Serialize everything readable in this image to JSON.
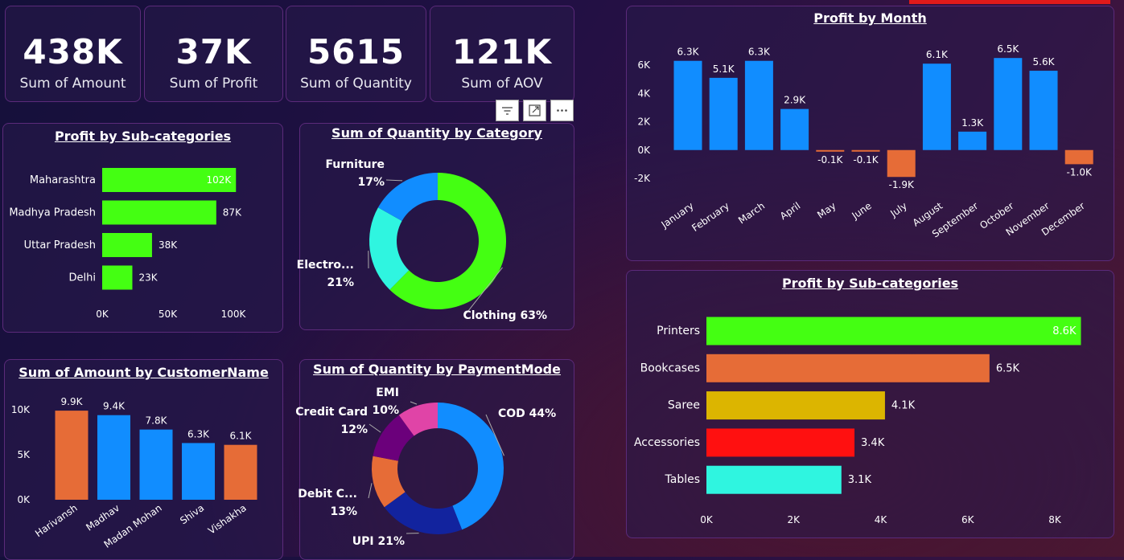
{
  "kpis": [
    {
      "value": "438K",
      "label": "Sum of Amount"
    },
    {
      "value": "37K",
      "label": "Sum of Profit"
    },
    {
      "value": "5615",
      "label": "Sum of Quantity"
    },
    {
      "value": "121K",
      "label": "Sum of AOV"
    }
  ],
  "toolbar": {
    "icons": [
      "filter-icon",
      "focus-mode-icon",
      "more-options-icon"
    ]
  },
  "colors": {
    "green": "#44ff12",
    "blue": "#118dff",
    "orange": "#e66c37",
    "cyan": "#2ff5e0",
    "red": "#ff1010",
    "yellow": "#dcb500",
    "purple": "#6b007b",
    "pink": "#e044a7",
    "navy": "#12239e"
  },
  "chart_data": [
    {
      "id": "state_profit",
      "type": "bar",
      "orientation": "horizontal",
      "title": "Profit by Sub-categories",
      "categories": [
        "Maharashtra",
        "Madhya Pradesh",
        "Uttar Pradesh",
        "Delhi"
      ],
      "values": [
        102000,
        87000,
        38000,
        23000
      ],
      "data_labels": [
        "102K",
        "87K",
        "38K",
        "23K"
      ],
      "xlim": [
        0,
        100000
      ],
      "xticks": [
        "0K",
        "50K",
        "100K"
      ],
      "color": "#44ff12",
      "grid": false
    },
    {
      "id": "qty_category",
      "type": "pie",
      "donut": true,
      "title": "Sum of Quantity by Category",
      "categories": [
        "Clothing",
        "Electronics",
        "Furniture"
      ],
      "values": [
        63,
        21,
        17
      ],
      "labels": [
        [
          "Clothing 63%"
        ],
        [
          "Electro...",
          "21%"
        ],
        [
          "Furniture",
          "17%"
        ]
      ],
      "colors": [
        "#44ff12",
        "#2ff5e0",
        "#118dff"
      ]
    },
    {
      "id": "amount_customer",
      "type": "bar",
      "title": "Sum of Amount by CustomerName",
      "categories": [
        "Harivansh",
        "Madhav",
        "Madan Mohan",
        "Shiva",
        "Vishakha"
      ],
      "values": [
        9900,
        9400,
        7800,
        6300,
        6100
      ],
      "data_labels": [
        "9.9K",
        "9.4K",
        "7.8K",
        "6.3K",
        "6.1K"
      ],
      "ylim": [
        0,
        10000
      ],
      "yticks": [
        "0K",
        "5K",
        "10K"
      ],
      "colors": [
        "#e66c37",
        "#118dff",
        "#118dff",
        "#118dff",
        "#e66c37"
      ],
      "grid": false
    },
    {
      "id": "qty_payment",
      "type": "pie",
      "donut": true,
      "title": "Sum of Quantity by PaymentMode",
      "categories": [
        "COD",
        "UPI",
        "Debit Card",
        "Credit Card",
        "EMI"
      ],
      "values": [
        44,
        21,
        13,
        12,
        10
      ],
      "labels": [
        [
          "COD 44%"
        ],
        [
          "UPI 21%"
        ],
        [
          "Debit C...",
          "13%"
        ],
        [
          "Credit Card",
          "12%"
        ],
        [
          "EMI",
          "10%"
        ]
      ],
      "colors": [
        "#118dff",
        "#12239e",
        "#e66c37",
        "#6b007b",
        "#e044a7"
      ]
    },
    {
      "id": "profit_month",
      "type": "bar",
      "title": "Profit by Month",
      "categories": [
        "January",
        "February",
        "March",
        "April",
        "May",
        "June",
        "July",
        "August",
        "September",
        "October",
        "November",
        "December"
      ],
      "values": [
        6300,
        5100,
        6300,
        2900,
        -100,
        -100,
        -1900,
        6100,
        1300,
        6500,
        5600,
        -1000
      ],
      "data_labels": [
        "6.3K",
        "5.1K",
        "6.3K",
        "2.9K",
        "-0.1K",
        "-0.1K",
        "-1.9K",
        "6.1K",
        "1.3K",
        "6.5K",
        "5.6K",
        "-1.0K"
      ],
      "ylim": [
        -2000,
        6000
      ],
      "yticks": [
        "-2K",
        "0K",
        "2K",
        "4K",
        "6K"
      ],
      "positive_color": "#118dff",
      "negative_color": "#e66c37",
      "grid": false
    },
    {
      "id": "profit_subcat",
      "type": "bar",
      "orientation": "horizontal",
      "title": "Profit by Sub-categories",
      "categories": [
        "Printers",
        "Bookcases",
        "Saree",
        "Accessories",
        "Tables"
      ],
      "values": [
        8600,
        6500,
        4100,
        3400,
        3100
      ],
      "data_labels": [
        "8.6K",
        "6.5K",
        "4.1K",
        "3.4K",
        "3.1K"
      ],
      "xlim": [
        0,
        8000
      ],
      "xticks": [
        "0K",
        "2K",
        "4K",
        "6K",
        "8K"
      ],
      "colors": [
        "#44ff12",
        "#e66c37",
        "#dcb500",
        "#ff1010",
        "#2ff5e0"
      ],
      "grid": false
    }
  ]
}
